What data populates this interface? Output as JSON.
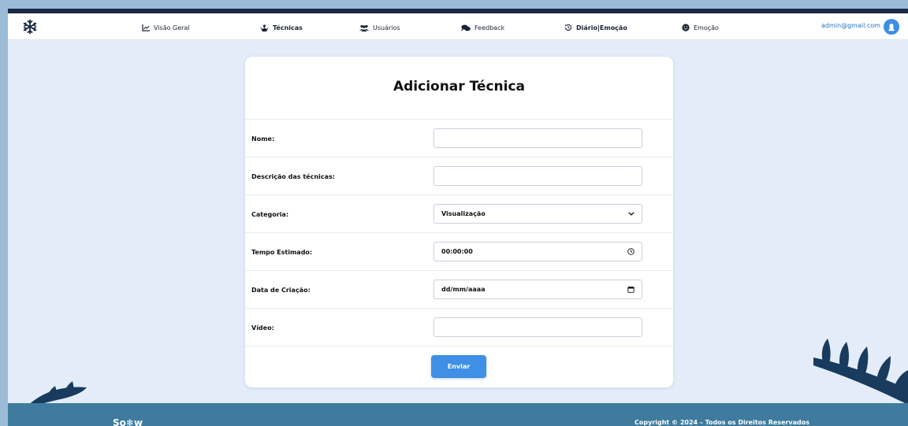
{
  "nav": {
    "items": [
      {
        "label": "Visão Geral",
        "icon": "chart-line-icon",
        "bold": false
      },
      {
        "label": "Técnicas",
        "icon": "hands-icon",
        "bold": true
      },
      {
        "label": "Usuários",
        "icon": "users-icon",
        "bold": false
      },
      {
        "label": "Feedback",
        "icon": "comments-icon",
        "bold": false
      },
      {
        "label": "Diário|Emoção",
        "icon": "history-icon",
        "bold": true
      },
      {
        "label": "Emoção",
        "icon": "smile-icon",
        "bold": false
      }
    ],
    "user_email": "admin@gmail.com"
  },
  "form": {
    "title": "Adicionar Técnica",
    "fields": [
      {
        "label": "Nome:",
        "value": "",
        "type": "text"
      },
      {
        "label": "Descrição das técnicas:",
        "value": "",
        "type": "text"
      },
      {
        "label": "Categoria:",
        "value": "Visualização",
        "type": "select"
      },
      {
        "label": "Tempo Estimado:",
        "value": "00:00:00",
        "type": "time"
      },
      {
        "label": "Data de Criação:",
        "value": "dd/mm/aaaa",
        "type": "date"
      },
      {
        "label": "Vídeo:",
        "value": "",
        "type": "text"
      }
    ],
    "submit_label": "Enviar"
  },
  "footer": {
    "brand": "So❄w",
    "copyright": "Copyright © 2024 – Todos os Direitos Reservados"
  },
  "colors": {
    "accent": "#3f8fe6",
    "footer": "#3e7b9f",
    "page_bg": "#e3ecf8",
    "nav_dark": "#1c2a44"
  }
}
